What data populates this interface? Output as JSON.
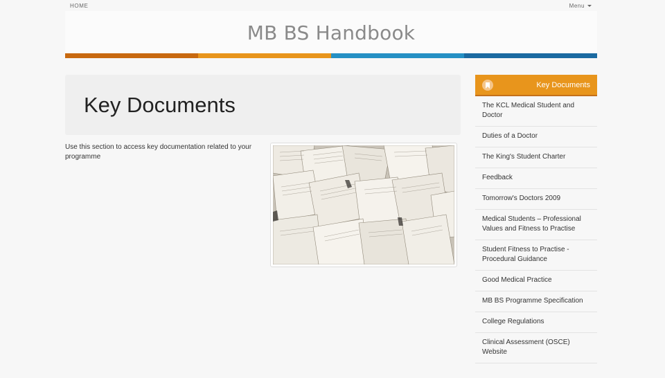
{
  "topbar": {
    "home_label": "HOME",
    "menu_label": "Menu"
  },
  "header": {
    "title": "MB BS Handbook"
  },
  "colors": {
    "stripe": [
      "#c8690f",
      "#e8951c",
      "#2590c4",
      "#1b6aa1"
    ],
    "sidebar_accent": "#e8951c"
  },
  "main": {
    "heading": "Key Documents",
    "intro": "Use this section to access key documentation related to your programme"
  },
  "sidebar": {
    "title": "Key Documents",
    "icon": "bookmark-icon",
    "items": [
      {
        "label": "The KCL Medical Student and Doctor"
      },
      {
        "label": "Duties of a Doctor"
      },
      {
        "label": "The King's Student Charter"
      },
      {
        "label": "Feedback"
      },
      {
        "label": "Tomorrow's Doctors 2009"
      },
      {
        "label": "Medical Students – Professional Values and Fitness to Practise"
      },
      {
        "label": "Student Fitness to Practise - Procedural Guidance"
      },
      {
        "label": "Good Medical Practice"
      },
      {
        "label": "MB BS Programme Specification"
      },
      {
        "label": "College Regulations"
      },
      {
        "label": "Clinical Assessment (OSCE) Website"
      }
    ]
  }
}
